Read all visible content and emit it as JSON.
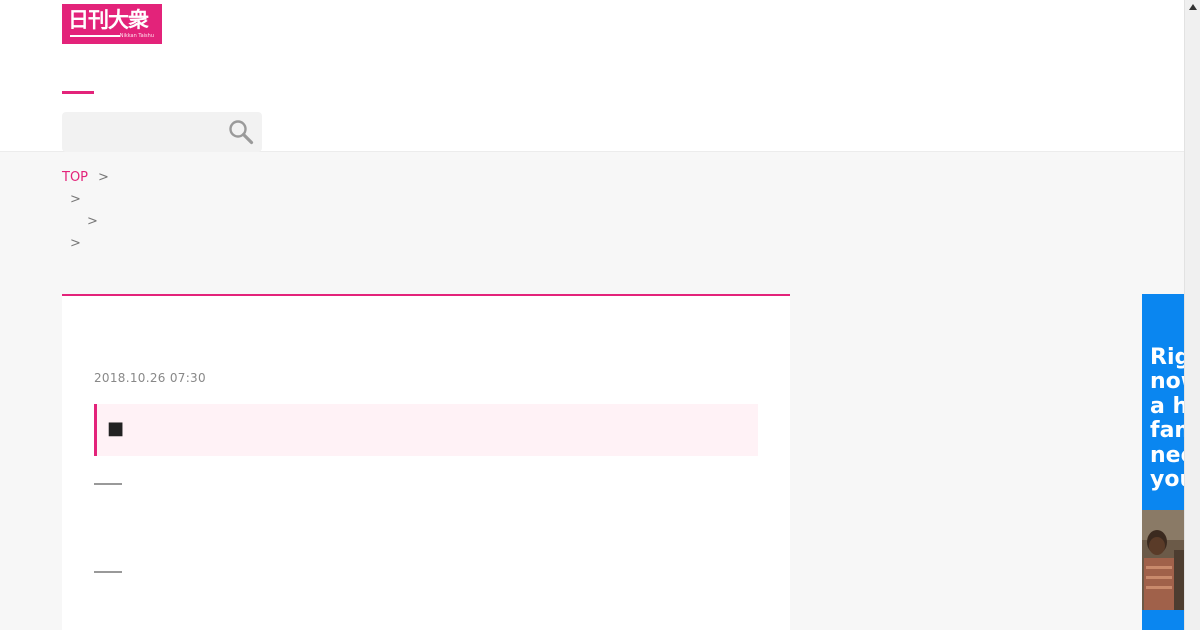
{
  "header": {
    "logo_text": "日刊大衆",
    "logo_sub": "Nikkan Taishu",
    "search": {
      "placeholder": "",
      "value": ""
    }
  },
  "breadcrumb": {
    "items": [
      {
        "label": "TOP",
        "separator": ">"
      },
      {
        "label": "",
        "separator": ">"
      },
      {
        "label": "",
        "separator": ">"
      },
      {
        "label": "",
        "separator": ">"
      }
    ]
  },
  "article": {
    "date": "2018.10.26 07:30",
    "lead_marker": "■",
    "dashes": [
      "――",
      "――"
    ]
  },
  "ad": {
    "headline": "Right\nnow\na hungry\nfamily\nneeds\nyou"
  },
  "colors": {
    "brand": "#e3237a",
    "lead_bg": "#fff2f6",
    "ad_bg": "#0a86f0",
    "page_bg": "#f7f7f7"
  },
  "icons": {
    "search": "magnifier",
    "scroll_up": "triangle-up"
  }
}
